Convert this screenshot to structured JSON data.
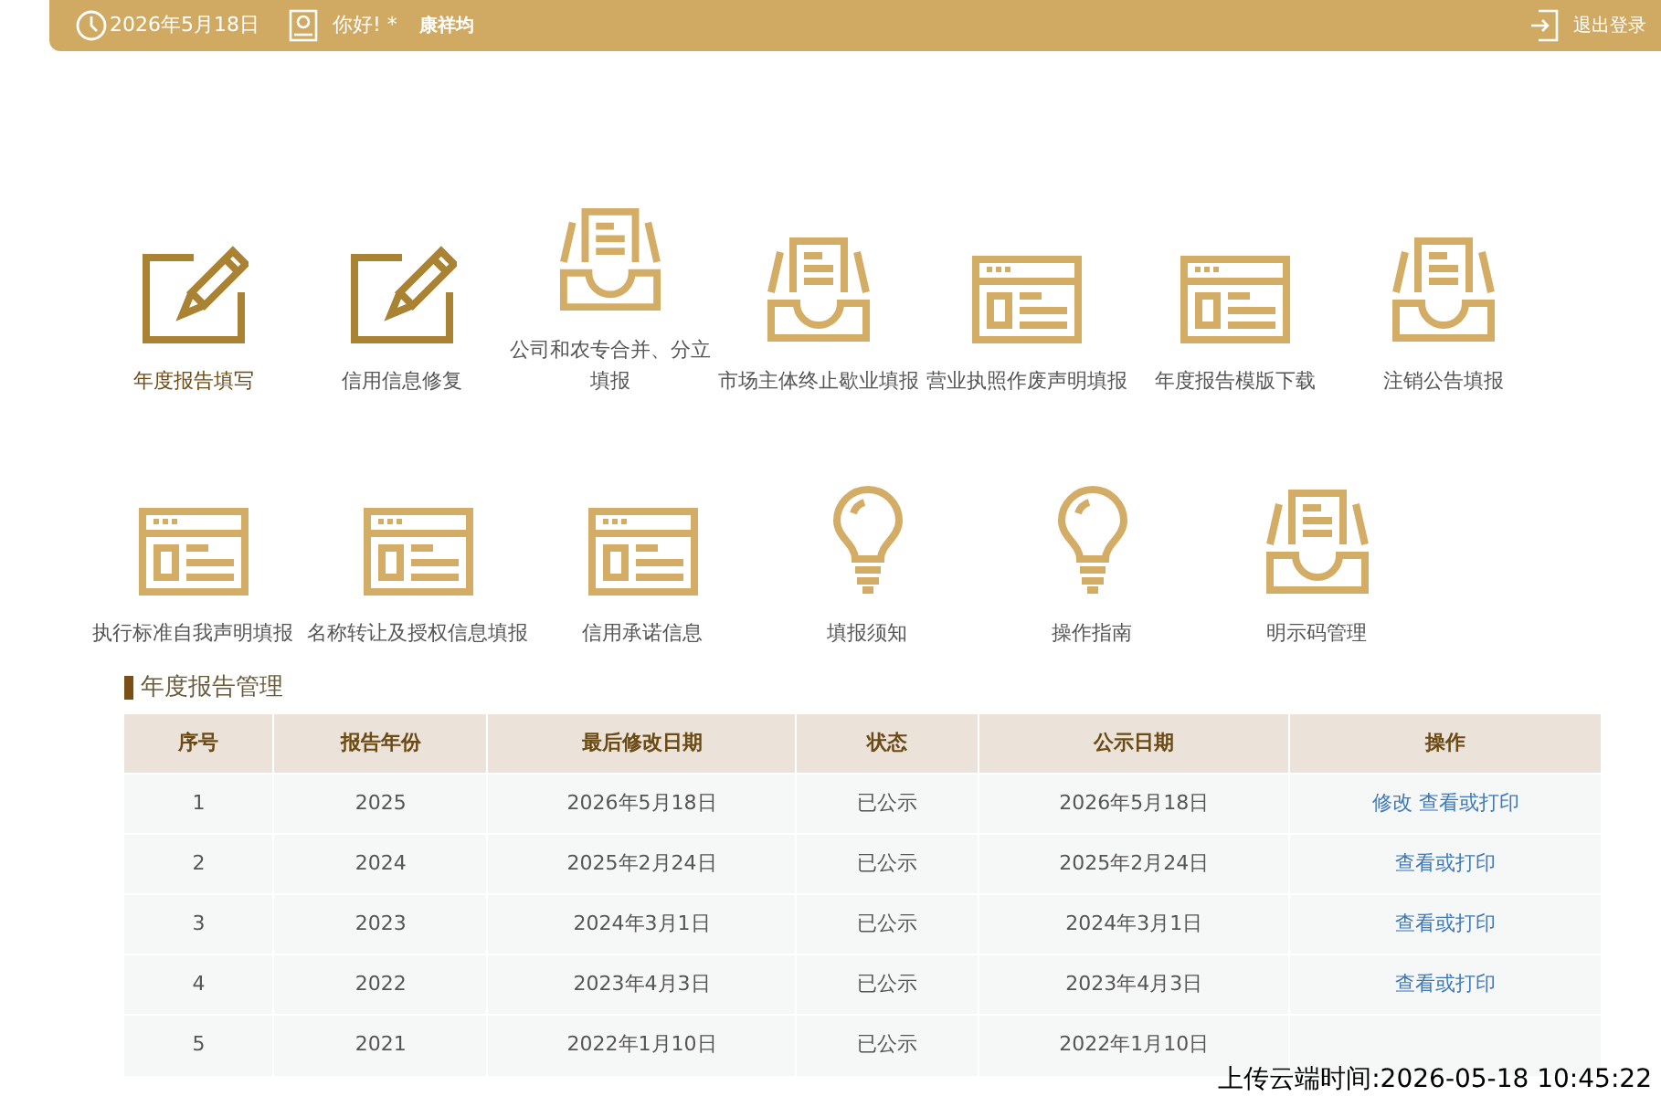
{
  "header": {
    "date": "2026年5月18日",
    "greeting": "你好! *",
    "user": "康祥均",
    "logout": "退出登录"
  },
  "tile_rows": [
    [
      {
        "kind": "pencil",
        "label": "年度报告填写",
        "selected": true
      },
      {
        "kind": "pencil",
        "label": "信用信息修复",
        "selected": false
      },
      {
        "kind": "tray",
        "label": "公司和农专合并、分立填报",
        "selected": false
      },
      {
        "kind": "tray",
        "label": "市场主体终止歇业填报",
        "selected": false
      },
      {
        "kind": "window",
        "label": "营业执照作废声明填报",
        "selected": false
      },
      {
        "kind": "window",
        "label": "年度报告模版下载",
        "selected": false
      },
      {
        "kind": "tray",
        "label": "注销公告填报",
        "selected": false
      }
    ],
    [
      {
        "kind": "window",
        "label": "执行标准自我声明填报",
        "selected": false
      },
      {
        "kind": "window",
        "label": "名称转让及授权信息填报",
        "selected": false
      },
      {
        "kind": "window",
        "label": "信用承诺信息",
        "selected": false
      },
      {
        "kind": "bulb",
        "label": "填报须知",
        "selected": false
      },
      {
        "kind": "bulb",
        "label": "操作指南",
        "selected": false
      },
      {
        "kind": "tray",
        "label": "明示码管理",
        "selected": false
      }
    ]
  ],
  "section_title": "年度报告管理",
  "table": {
    "columns": [
      "序号",
      "报告年份",
      "最后修改日期",
      "状态",
      "公示日期",
      "操作"
    ],
    "rows": [
      {
        "cells": [
          "1",
          "2025",
          "2026年5月18日",
          "已公示",
          "2026年5月18日"
        ],
        "actions": [
          "修改",
          "查看或打印"
        ]
      },
      {
        "cells": [
          "2",
          "2024",
          "2025年2月24日",
          "已公示",
          "2025年2月24日"
        ],
        "actions": [
          "查看或打印"
        ]
      },
      {
        "cells": [
          "3",
          "2023",
          "2024年3月1日",
          "已公示",
          "2024年3月1日"
        ],
        "actions": [
          "查看或打印"
        ]
      },
      {
        "cells": [
          "4",
          "2022",
          "2023年4月3日",
          "已公示",
          "2023年4月3日"
        ],
        "actions": [
          "查看或打印"
        ]
      },
      {
        "cells": [
          "5",
          "2021",
          "2022年1月10日",
          "已公示",
          "2022年1月10日"
        ]
      }
    ]
  },
  "overlay": "上传云端时间:2026-05-18 10:45:22"
}
